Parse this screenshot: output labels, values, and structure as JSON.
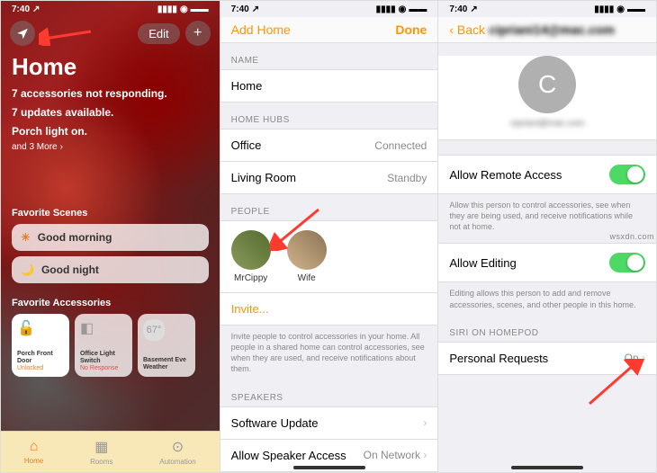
{
  "status": {
    "time": "7:40",
    "loc": "↗"
  },
  "s1": {
    "edit": "Edit",
    "title": "Home",
    "line1": "7 accessories not responding.",
    "line2": "7 updates available.",
    "line3": "Porch light on.",
    "more": "and 3 More",
    "scenes_h": "Favorite Scenes",
    "scenes": [
      {
        "icon": "☀",
        "label": "Good morning"
      },
      {
        "icon": "🌙",
        "label": "Good night"
      }
    ],
    "acc_h": "Favorite Accessories",
    "acc": [
      {
        "icon": "🔓",
        "name": "Porch Front Door",
        "status": "Unlocked",
        "cls": "orange",
        "active": true
      },
      {
        "icon": "◧",
        "name": "Office Light Switch",
        "status": "No Response",
        "cls": "red"
      },
      {
        "icon": "67°",
        "name": "Basement Eve Weather",
        "status": "",
        "cls": ""
      }
    ],
    "tabs": [
      {
        "icon": "⌂",
        "label": "Home"
      },
      {
        "icon": "▦",
        "label": "Rooms"
      },
      {
        "icon": "⊙",
        "label": "Automation"
      }
    ]
  },
  "s2": {
    "back": "Add Home",
    "done": "Done",
    "name_h": "NAME",
    "name_v": "Home",
    "hubs_h": "HOME HUBS",
    "hubs": [
      {
        "name": "Office",
        "status": "Connected"
      },
      {
        "name": "Living Room",
        "status": "Standby"
      }
    ],
    "people_h": "PEOPLE",
    "people": [
      {
        "name": "MrCippy"
      },
      {
        "name": "Wife"
      }
    ],
    "invite": "Invite...",
    "invite_foot": "Invite people to control accessories in your home. All people in a shared home can control accessories, see when they are used, and receive notifications about them.",
    "speakers_h": "SPEAKERS",
    "sw": "Software Update",
    "spk": "Allow Speaker Access",
    "spk_v": "On Network"
  },
  "s3": {
    "back": "Back",
    "title": "cipriani14@mac.com",
    "avatar": "C",
    "sub": "cipriani@mac.com",
    "remote": "Allow Remote Access",
    "remote_foot": "Allow this person to control accessories, see when they are being used, and receive notifications while not at home.",
    "edit": "Allow Editing",
    "edit_foot": "Editing allows this person to add and remove accessories, scenes, and other people in this home.",
    "siri_h": "SIRI ON HOMEPOD",
    "pr": "Personal Requests",
    "pr_v": "On"
  },
  "watermark": "wsxdn.com"
}
